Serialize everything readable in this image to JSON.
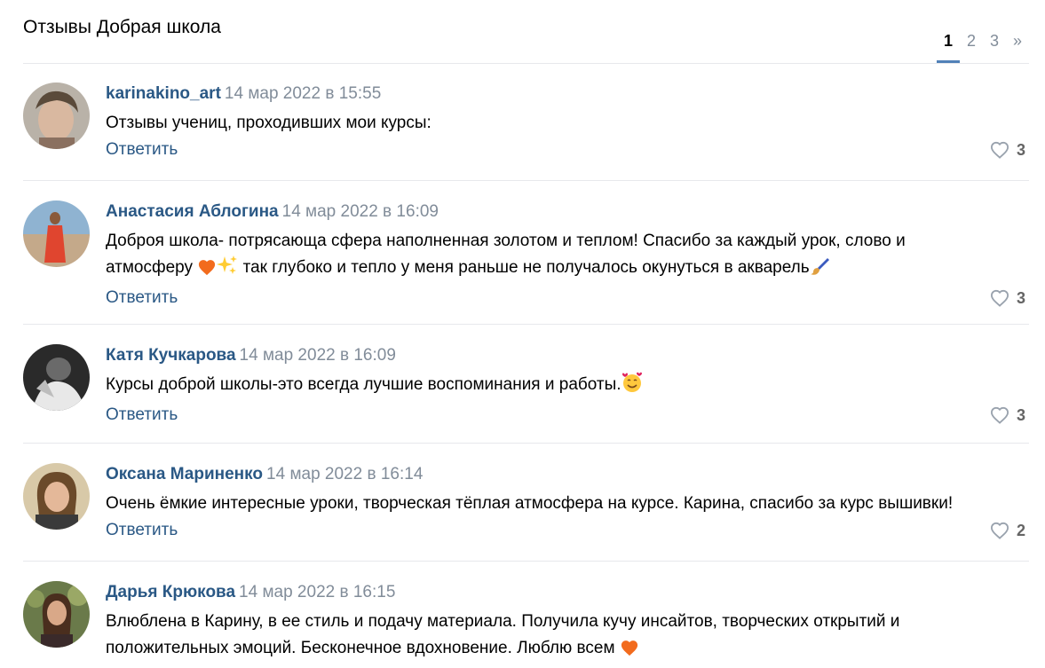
{
  "header": {
    "title": "Отзывы Добрая школа",
    "pages": [
      "1",
      "2",
      "3",
      "»"
    ],
    "active_page": "1"
  },
  "reply_label": "Ответить",
  "comments": [
    {
      "author": "karinakino_art",
      "date": "14 мар 2022 в 15:55",
      "text": "Отзывы учениц, проходивших мои курсы:",
      "likes": "3"
    },
    {
      "author": "Анастасия Аблогина",
      "date": "14 мар 2022 в 16:09",
      "text1": "Доброя школа- потрясающа сфера наполненная золотом и теплом! Спасибо за каждый урок, слово и атмосферу",
      "text2": " так глубоко и тепло у меня раньше не получалось окунуться в акварель",
      "likes": "3"
    },
    {
      "author": "Катя Кучкарова",
      "date": "14 мар 2022 в 16:09",
      "text": "Курсы доброй школы-это всегда лучшие воспоминания и работы.",
      "likes": "3"
    },
    {
      "author": "Оксана Мариненко",
      "date": "14 мар 2022 в 16:14",
      "text": "Очень ёмкие интересные уроки, творческая тёплая атмосфера на курсе. Карина, спасибо за курс вышивки!",
      "likes": "2"
    },
    {
      "author": "Дарья Крюкова",
      "date": "14 мар 2022 в 16:15",
      "text": "Влюблена в Карину, в ее стиль и подачу материала. Получила кучу инсайтов, творческих открытий и положительных эмоций. Бесконечное вдохновение. Люблю всем",
      "likes": ""
    }
  ],
  "icons": {
    "like": "heart-outline-icon",
    "emoji_heart": "orange-heart-emoji",
    "emoji_sparkles": "sparkles-emoji",
    "emoji_brush": "paintbrush-emoji",
    "emoji_face": "smiling-face-with-hearts-emoji"
  },
  "colors": {
    "link": "#2a5885",
    "meta": "#818c99",
    "divider": "#e7e8ec",
    "accent": "#5181b8"
  }
}
